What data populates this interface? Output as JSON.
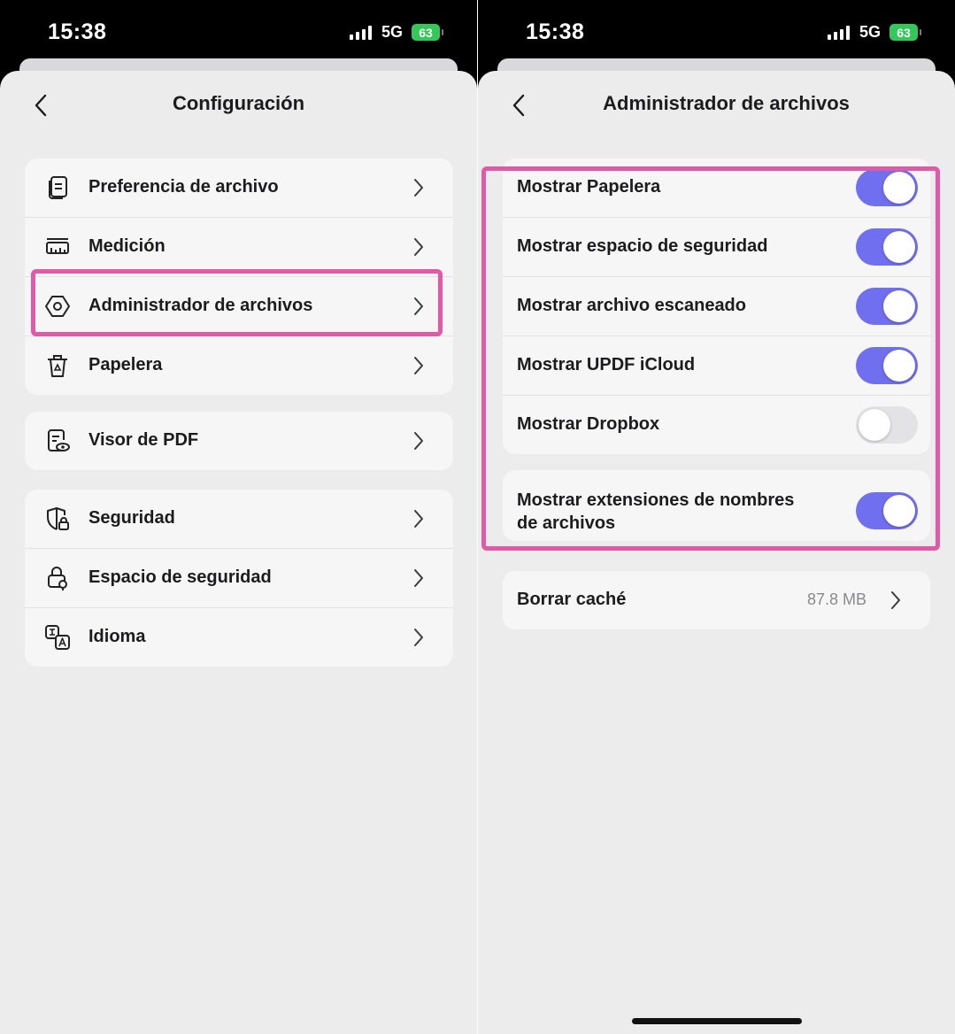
{
  "status_bar": {
    "time": "15:38",
    "network": "5G",
    "battery": "63"
  },
  "left_screen": {
    "title": "Configuración",
    "groups": [
      [
        {
          "label": "Preferencia de archivo",
          "icon": "file-preference-icon"
        },
        {
          "label": "Medición",
          "icon": "ruler-icon"
        },
        {
          "label": "Administrador de archivos",
          "icon": "hexagon-settings-icon"
        },
        {
          "label": "Papelera",
          "icon": "trash-icon"
        }
      ],
      [
        {
          "label": "Visor de PDF",
          "icon": "pdf-viewer-icon"
        }
      ],
      [
        {
          "label": "Seguridad",
          "icon": "shield-lock-icon"
        },
        {
          "label": "Espacio de seguridad",
          "icon": "secure-space-lock-icon"
        },
        {
          "label": "Idioma",
          "icon": "language-icon"
        }
      ]
    ]
  },
  "right_screen": {
    "title": "Administrador de archivos",
    "toggles": [
      {
        "label": "Mostrar Papelera",
        "on": true
      },
      {
        "label": "Mostrar espacio de seguridad",
        "on": true
      },
      {
        "label": "Mostrar archivo escaneado",
        "on": true
      },
      {
        "label": "Mostrar UPDF iCloud",
        "on": true
      },
      {
        "label": "Mostrar Dropbox",
        "on": false
      }
    ],
    "extensions_toggle": {
      "label_line1": "Mostrar extensiones de nombres",
      "label_line2": "de archivos",
      "on": true
    },
    "cache": {
      "label": "Borrar caché",
      "value": "87.8 MB"
    }
  },
  "colors": {
    "toggle_on": "#6f6ff0",
    "toggle_off": "#e3e3e6",
    "highlight": "#e05aa8",
    "battery": "#34c759",
    "background": "#ececec",
    "card": "#f6f6f6"
  }
}
